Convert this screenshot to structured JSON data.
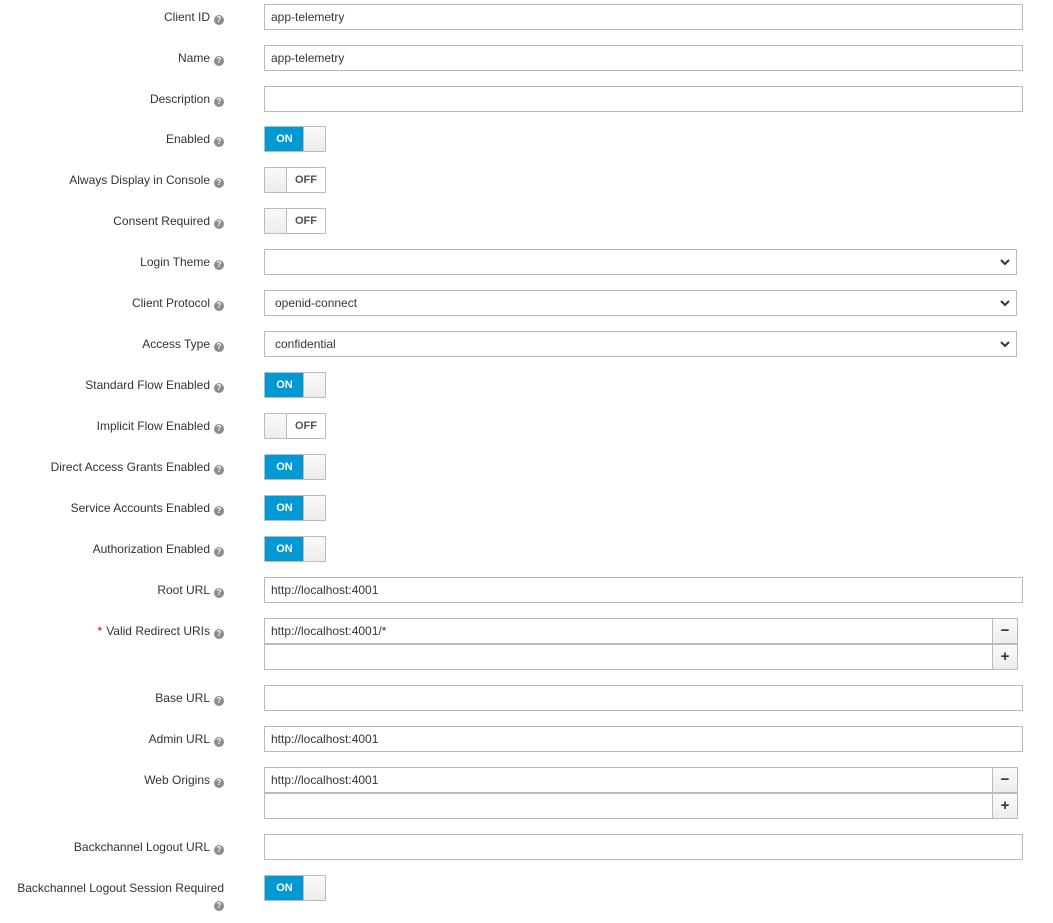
{
  "fields": {
    "client_id": {
      "label": "Client ID",
      "value": "app-telemetry"
    },
    "name": {
      "label": "Name",
      "value": "app-telemetry"
    },
    "description": {
      "label": "Description",
      "value": ""
    },
    "enabled": {
      "label": "Enabled",
      "state": "ON"
    },
    "always_display": {
      "label": "Always Display in Console",
      "state": "OFF"
    },
    "consent_required": {
      "label": "Consent Required",
      "state": "OFF"
    },
    "login_theme": {
      "label": "Login Theme",
      "value": ""
    },
    "client_protocol": {
      "label": "Client Protocol",
      "value": "openid-connect"
    },
    "access_type": {
      "label": "Access Type",
      "value": "confidential"
    },
    "standard_flow": {
      "label": "Standard Flow Enabled",
      "state": "ON"
    },
    "implicit_flow": {
      "label": "Implicit Flow Enabled",
      "state": "OFF"
    },
    "direct_access": {
      "label": "Direct Access Grants Enabled",
      "state": "ON"
    },
    "service_accounts": {
      "label": "Service Accounts Enabled",
      "state": "ON"
    },
    "authorization": {
      "label": "Authorization Enabled",
      "state": "ON"
    },
    "root_url": {
      "label": "Root URL",
      "value": "http://localhost:4001"
    },
    "valid_redirect": {
      "label": "Valid Redirect URIs",
      "required_mark": "*",
      "values": [
        "http://localhost:4001/*",
        ""
      ]
    },
    "base_url": {
      "label": "Base URL",
      "value": ""
    },
    "admin_url": {
      "label": "Admin URL",
      "value": "http://localhost:4001"
    },
    "web_origins": {
      "label": "Web Origins",
      "values": [
        "http://localhost:4001",
        ""
      ]
    },
    "backchannel_url": {
      "label": "Backchannel Logout URL",
      "value": ""
    },
    "backchannel_session": {
      "label": "Backchannel Logout Session Required",
      "state": "ON"
    }
  },
  "ui": {
    "help_glyph": "?",
    "remove_glyph": "−",
    "add_glyph": "+",
    "accent_color": "#0099d3",
    "icons": {
      "help": "question-circle-icon",
      "select": "chevron-down-icon"
    }
  }
}
